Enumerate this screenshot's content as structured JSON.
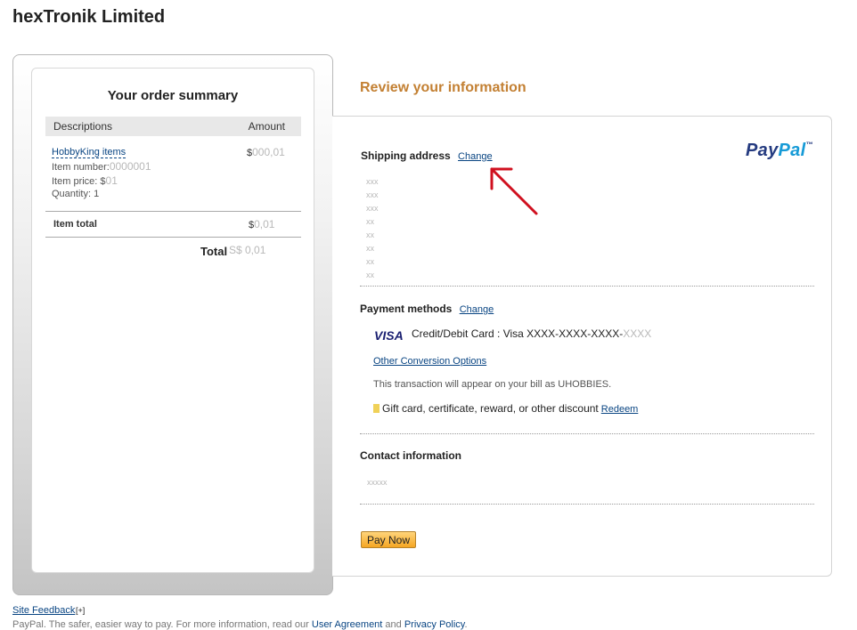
{
  "merchant": {
    "name": "hexTronik Limited"
  },
  "order_summary": {
    "title": "Your order summary",
    "columns": {
      "description": "Descriptions",
      "amount": "Amount"
    },
    "item": {
      "name": "HobbyKing items",
      "number_label": "Item number:",
      "number_value": "0000001",
      "price_label": "Item price: $",
      "price_value": "01",
      "quantity_label": "Quantity: 1",
      "amount_currency": "$",
      "amount_value": "000,01"
    },
    "item_total": {
      "label": "Item total",
      "currency": "$",
      "value": "0,01"
    },
    "total": {
      "label": "Total",
      "value": "S$ 0,01"
    }
  },
  "review": {
    "title": "Review your information",
    "logo": {
      "pay": "Pay",
      "pal": "Pal",
      "tm": "™"
    },
    "shipping": {
      "heading": "Shipping address",
      "change": "Change",
      "lines": [
        "xxx",
        "xxx",
        "xxx",
        "xx",
        "xx",
        "xx",
        "xx",
        "xx"
      ]
    },
    "payment": {
      "heading": "Payment methods",
      "change": "Change",
      "card_brand": "VISA",
      "card_text": "Credit/Debit Card : Visa XXXX-XXXX-XXXX-",
      "card_mask": "XXXX",
      "other_options": "Other Conversion Options",
      "bill_note": "This transaction will appear on your bill as UHOBBIES.",
      "gift_text": "Gift card, certificate, reward, or other discount",
      "redeem": "Redeem"
    },
    "contact": {
      "heading": "Contact information",
      "value": "xxxxx"
    },
    "pay_now": "Pay Now"
  },
  "footer": {
    "feedback": "Site Feedback",
    "feedback_plus": "[+]",
    "tagline": "PayPal. The safer, easier way to pay. For more information, read our",
    "user_agreement": "User Agreement",
    "and": "and",
    "privacy": "Privacy Policy",
    "period": "."
  },
  "colors": {
    "accent": "#c38033",
    "link": "#084482",
    "button": "#f5a623",
    "annotation_arrow": "#d0101f"
  },
  "icons": {
    "annotation": "red-arrow-icon"
  }
}
